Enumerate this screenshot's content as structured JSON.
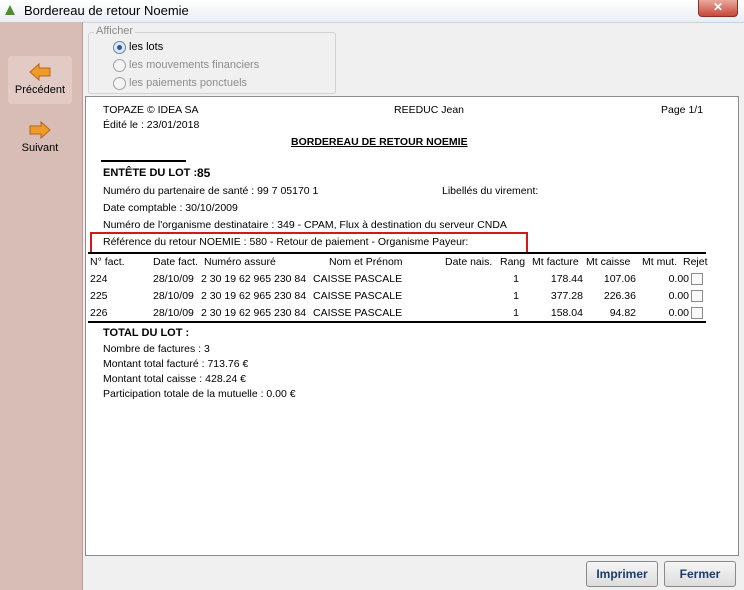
{
  "window": {
    "title": "Bordereau de retour Noemie",
    "close_glyph": "✕"
  },
  "nav": {
    "prev_label": "Précédent",
    "next_label": "Suivant"
  },
  "afficher": {
    "legend": "Afficher",
    "options": [
      "les lots",
      "les mouvements financiers",
      "les paiements ponctuels"
    ],
    "selected": "les lots"
  },
  "report": {
    "company": "TOPAZE © IDEA SA",
    "user": "REEDUC Jean",
    "page": "Page 1/1",
    "edited": "Édité le : 23/01/2018",
    "title": "BORDEREAU DE RETOUR NOEMIE",
    "lot_label": "ENTÊTE DU LOT :",
    "lot_number": "85",
    "partenaire": "Numéro du partenaire de santé : 99 7 05170 1",
    "libelles": "Libellés du virement:",
    "date_comptable": "Date comptable : 30/10/2009",
    "organisme": "Numéro de l'organisme destinataire : 349 - CPAM, Flux à destination du serveur CNDA",
    "reference": "Référence du retour NOEMIE : 580 - Retour de paiement - Organisme Payeur:",
    "columns": [
      "N° fact.",
      "Date fact.",
      "Numéro assuré",
      "Nom et Prénom",
      "Date nais.",
      "Rang",
      "Mt facture",
      "Mt caisse",
      "Mt mut.",
      "Rejet"
    ],
    "rows": [
      {
        "fact": "224",
        "date": "28/10/09",
        "assure": "2 30 19 62 965 230 84",
        "nom": "CAISSE PASCALE",
        "rang": "1",
        "facture": "178.44",
        "caisse": "107.06",
        "mut": "0.00"
      },
      {
        "fact": "225",
        "date": "28/10/09",
        "assure": "2 30 19 62 965 230 84",
        "nom": "CAISSE PASCALE",
        "rang": "1",
        "facture": "377.28",
        "caisse": "226.36",
        "mut": "0.00"
      },
      {
        "fact": "226",
        "date": "28/10/09",
        "assure": "2 30 19 62 965 230 84",
        "nom": "CAISSE PASCALE",
        "rang": "1",
        "facture": "158.04",
        "caisse": "94.82",
        "mut": "0.00"
      }
    ],
    "total_label": "TOTAL DU LOT :",
    "nb_factures": "Nombre de factures : 3",
    "montant_facture": "Montant total facturé : 713.76 €",
    "montant_caisse": "Montant total caisse : 428.24 €",
    "participation": "Participation totale de la mutuelle : 0.00 €"
  },
  "buttons": {
    "print": "Imprimer",
    "close": "Fermer"
  },
  "colors": {
    "nav_bg": "#d8bdb6",
    "highlight": "#d01919",
    "button_text": "#1d3c6a"
  }
}
